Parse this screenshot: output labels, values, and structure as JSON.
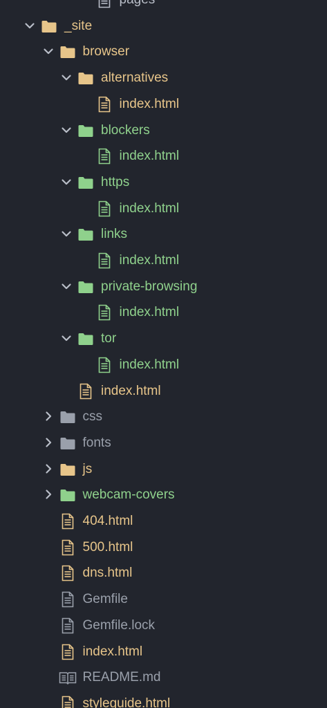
{
  "colors": {
    "background": "#22252d",
    "modified": "#e7c58a",
    "added": "#8fd18c",
    "ignored": "#9aa0ab",
    "default": "#b9bec8",
    "chevron": "#b9bec8"
  },
  "rows": [
    {
      "label": "pages",
      "kind": "file",
      "depth": 3,
      "color": "white",
      "icon": "file-text-icon"
    },
    {
      "label": "_site",
      "kind": "folder",
      "depth": 0,
      "expanded": true,
      "color": "yellow",
      "icon": "folder-icon"
    },
    {
      "label": "browser",
      "kind": "folder",
      "depth": 1,
      "expanded": true,
      "color": "yellow",
      "icon": "folder-icon"
    },
    {
      "label": "alternatives",
      "kind": "folder",
      "depth": 2,
      "expanded": true,
      "color": "yellow",
      "icon": "folder-icon"
    },
    {
      "label": "index.html",
      "kind": "file",
      "depth": 3,
      "color": "yellow",
      "icon": "file-text-icon"
    },
    {
      "label": "blockers",
      "kind": "folder",
      "depth": 2,
      "expanded": true,
      "color": "green",
      "icon": "folder-icon"
    },
    {
      "label": "index.html",
      "kind": "file",
      "depth": 3,
      "color": "green",
      "icon": "file-text-icon"
    },
    {
      "label": "https",
      "kind": "folder",
      "depth": 2,
      "expanded": true,
      "color": "green",
      "icon": "folder-icon"
    },
    {
      "label": "index.html",
      "kind": "file",
      "depth": 3,
      "color": "green",
      "icon": "file-text-icon"
    },
    {
      "label": "links",
      "kind": "folder",
      "depth": 2,
      "expanded": true,
      "color": "green",
      "icon": "folder-icon"
    },
    {
      "label": "index.html",
      "kind": "file",
      "depth": 3,
      "color": "green",
      "icon": "file-text-icon"
    },
    {
      "label": "private-browsing",
      "kind": "folder",
      "depth": 2,
      "expanded": true,
      "color": "green",
      "icon": "folder-icon"
    },
    {
      "label": "index.html",
      "kind": "file",
      "depth": 3,
      "color": "green",
      "icon": "file-text-icon"
    },
    {
      "label": "tor",
      "kind": "folder",
      "depth": 2,
      "expanded": true,
      "color": "green",
      "icon": "folder-icon"
    },
    {
      "label": "index.html",
      "kind": "file",
      "depth": 3,
      "color": "green",
      "icon": "file-text-icon"
    },
    {
      "label": "index.html",
      "kind": "file",
      "depth": 2,
      "color": "yellow",
      "icon": "file-text-icon"
    },
    {
      "label": "css",
      "kind": "folder",
      "depth": 1,
      "expanded": false,
      "color": "grey",
      "icon": "folder-icon"
    },
    {
      "label": "fonts",
      "kind": "folder",
      "depth": 1,
      "expanded": false,
      "color": "grey",
      "icon": "folder-icon"
    },
    {
      "label": "js",
      "kind": "folder",
      "depth": 1,
      "expanded": false,
      "color": "yellow",
      "icon": "folder-icon"
    },
    {
      "label": "webcam-covers",
      "kind": "folder",
      "depth": 1,
      "expanded": false,
      "color": "green",
      "icon": "folder-icon"
    },
    {
      "label": "404.html",
      "kind": "file",
      "depth": 1,
      "color": "yellow",
      "icon": "file-text-icon"
    },
    {
      "label": "500.html",
      "kind": "file",
      "depth": 1,
      "color": "yellow",
      "icon": "file-text-icon"
    },
    {
      "label": "dns.html",
      "kind": "file",
      "depth": 1,
      "color": "yellow",
      "icon": "file-text-icon"
    },
    {
      "label": "Gemfile",
      "kind": "file",
      "depth": 1,
      "color": "grey",
      "icon": "file-text-icon"
    },
    {
      "label": "Gemfile.lock",
      "kind": "file",
      "depth": 1,
      "color": "grey",
      "icon": "file-text-icon"
    },
    {
      "label": "index.html",
      "kind": "file",
      "depth": 1,
      "color": "yellow",
      "icon": "file-text-icon"
    },
    {
      "label": "README.md",
      "kind": "file",
      "depth": 1,
      "color": "grey",
      "icon": "book-icon"
    },
    {
      "label": "styleguide.html",
      "kind": "file",
      "depth": 1,
      "color": "yellow",
      "icon": "file-text-icon"
    }
  ]
}
